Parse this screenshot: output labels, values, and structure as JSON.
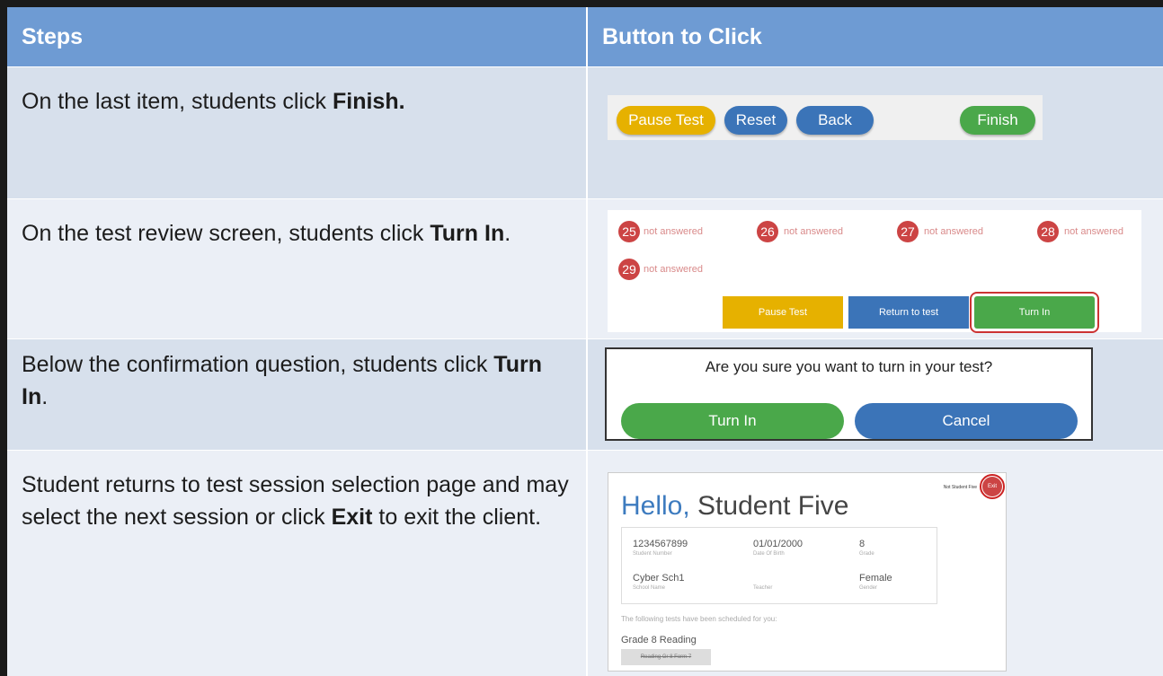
{
  "header": {
    "col1": "Steps",
    "col2": "Button to Click"
  },
  "rows": [
    {
      "pre": "On the last item, students click ",
      "bold": "Finish.",
      "post": ""
    },
    {
      "pre": "On the test review screen, students click ",
      "bold": "Turn In",
      "post": "."
    },
    {
      "pre": "Below the confirmation question, students click ",
      "bold": "Turn In",
      "post": "."
    },
    {
      "pre": "Student returns to test session selection page and may select the next session or click ",
      "bold": "Exit",
      "post": " to exit the client."
    }
  ],
  "toolbar": {
    "pause": "Pause Test",
    "reset": "Reset",
    "back": "Back",
    "finish": "Finish"
  },
  "colors": {
    "yellow": "#e6b100",
    "blue": "#3b74b8",
    "green": "#4aa84a",
    "red": "#cc4444",
    "header": "#6e9bd3"
  },
  "review": {
    "items": [
      {
        "num": "25",
        "status": "not answered"
      },
      {
        "num": "26",
        "status": "not answered"
      },
      {
        "num": "27",
        "status": "not answered"
      },
      {
        "num": "28",
        "status": "not answered"
      },
      {
        "num": "29",
        "status": "not answered"
      }
    ],
    "pause": "Pause Test",
    "return": "Return to test",
    "turnin": "Turn In"
  },
  "dialog": {
    "question": "Are you sure you want to turn in your test?",
    "turnin": "Turn In",
    "cancel": "Cancel"
  },
  "hello": {
    "greeting": "Hello,",
    "name": "Student Five",
    "topbar_text": "Not Student Five",
    "exit": "Exit",
    "student_number": "1234567899",
    "student_number_label": "Student Number",
    "dob": "01/01/2000",
    "dob_label": "Date Of Birth",
    "grade": "8",
    "grade_label": "Grade",
    "school": "Cyber Sch1",
    "school_label": "School Name",
    "teacher_label": "Teacher",
    "gender": "Female",
    "gender_label": "Gender",
    "scheduled": "The following tests have been scheduled for you:",
    "test_name": "Grade 8 Reading",
    "session": "Reading Gr 8 Form 7"
  }
}
